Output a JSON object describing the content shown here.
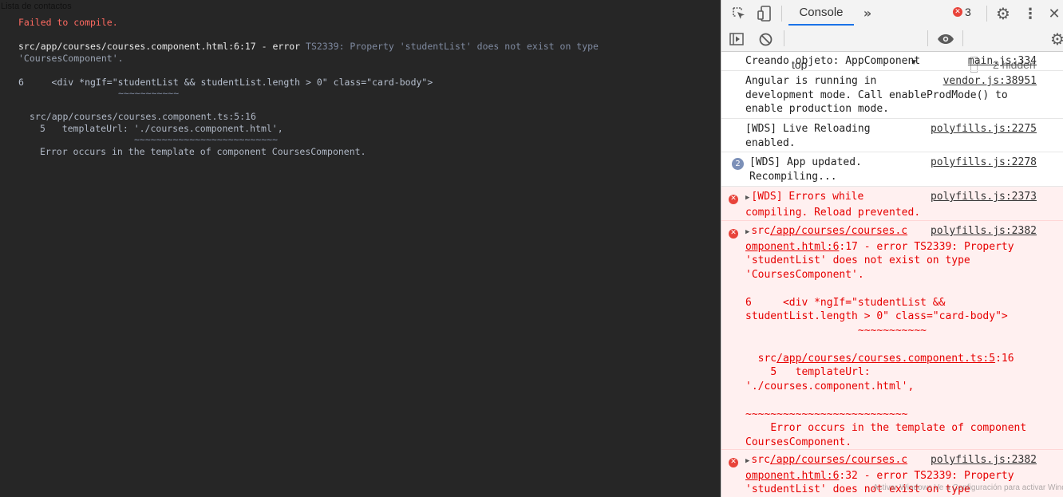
{
  "page": {
    "title": "Lista de contactos"
  },
  "overlay": {
    "heading": "Failed to compile.",
    "location": "src/app/courses/courses.component.html:6:17 - error ",
    "code": "TS2339: Property 'studentList' does not exist on type",
    "message": "'CoursesComponent'.",
    "code_line": "6     <div *ngIf=\"studentList && studentList.length > 0\" class=\"card-body\">",
    "code_underline": "~~~~~~~~~~~",
    "ts_location": "src/app/courses/courses.component.ts:5:16",
    "ts_line": "5   templateUrl: './courses.component.html',",
    "ts_underline": "~~~~~~~~~~~~~~~~~~~~~~~~~~",
    "template_error": "Error occurs in the template of component CoursesComponent."
  },
  "devtools": {
    "tab_label": "Console",
    "error_count": "3",
    "context": "top",
    "hidden_label": "2 hidden",
    "icons": [
      "inspect-icon",
      "device-toolbar-icon",
      "more-tabs-icon",
      "settings-icon",
      "kebab-menu-icon",
      "close-icon",
      "sidebar-toggle-icon",
      "clear-console-icon",
      "eye-icon",
      "gear-icon"
    ],
    "messages": [
      {
        "text": "Creando objeto: AppComponent",
        "source": "main.js:334"
      },
      {
        "text": "Angular is running in\ndevelopment mode. Call enableProdMode() to\nenable production mode.",
        "source": "vendor.js:38951"
      },
      {
        "text": "[WDS] Live Reloading\nenabled.",
        "source": "polyfills.js:2275"
      },
      {
        "count": "2",
        "text": "[WDS] App updated.\nRecompiling...",
        "source": "polyfills.js:2278"
      }
    ],
    "errors": [
      {
        "text": "[WDS] Errors while\ncompiling. Reload prevented.",
        "source": "polyfills.js:2373"
      },
      {
        "src_prefix": "src",
        "src_path": "/app/courses/courses.c",
        "src_path2": "omponent.html:6",
        "body": ":17 - error TS2339: Property\n'studentList' does not exist on type\n'CoursesComponent'.\n\n6     <div *ngIf=\"studentList &&\nstudentList.length > 0\" class=\"card-body\">\n                  ~~~~~~~~~~~\n\n  src",
        "ts_link": "/app/courses/courses.component.ts:5",
        "body2": ":16\n    5   templateUrl:\n'./courses.component.html',\n\n~~~~~~~~~~~~~~~~~~~~~~~~~~\n    Error occurs in the template of component\nCoursesComponent.",
        "source": "polyfills.js:2382"
      },
      {
        "src_prefix": "src",
        "src_path": "/app/courses/courses.c",
        "src_path2": "omponent.html:6",
        "body": ":32 - error TS2339: Property\n'studentList' does not exist on type",
        "source": "polyfills.js:2382"
      }
    ]
  },
  "watermark": "Activar Windows  Ve a Configuración para activar Windows."
}
